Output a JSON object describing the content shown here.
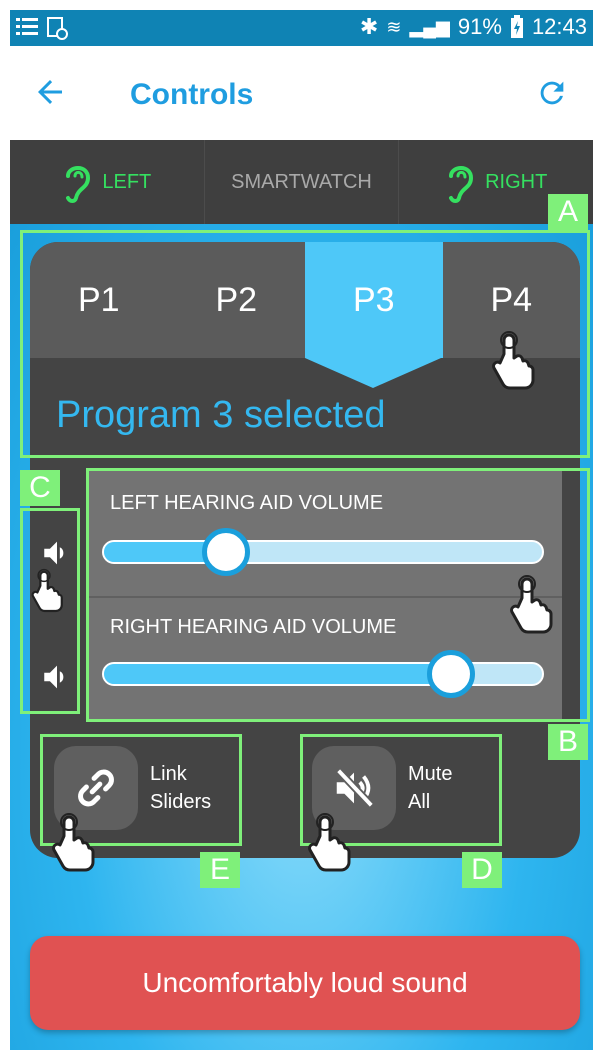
{
  "status_bar": {
    "battery": "91%",
    "time": "12:43",
    "icons": [
      "menu-icon",
      "notification-icon",
      "bluetooth-icon",
      "wifi-icon",
      "signal-icon",
      "battery-icon"
    ]
  },
  "header": {
    "title": "Controls",
    "back_icon": "arrow-left-icon",
    "refresh_icon": "refresh-icon"
  },
  "top_tabs": [
    {
      "label": "LEFT",
      "icon": "ear-icon",
      "active": true
    },
    {
      "label": "SMARTWATCH",
      "active": false
    },
    {
      "label": "RIGHT",
      "icon": "ear-icon",
      "active": true
    }
  ],
  "programs": {
    "tabs": [
      "P1",
      "P2",
      "P3",
      "P4"
    ],
    "selected": "P3",
    "status": "Program 3 selected"
  },
  "volume": {
    "left_label": "LEFT HEARING AID VOLUME",
    "right_label": "RIGHT HEARING AID VOLUME",
    "left_level": 0.28,
    "right_level": 0.79
  },
  "actions": {
    "link": {
      "line1": "Link",
      "line2": "Sliders"
    },
    "mute": {
      "line1": "Mute",
      "line2": "All"
    }
  },
  "annotations": {
    "a": "A",
    "b": "B",
    "c": "C",
    "d": "D",
    "e": "E"
  },
  "bottom_button": "Uncomfortably loud sound",
  "colors": {
    "accent": "#1f9de0",
    "program_selected": "#4ec8f8",
    "active_green": "#35e060",
    "annotation_green": "#7ff07a",
    "alert_red": "#e05252"
  }
}
